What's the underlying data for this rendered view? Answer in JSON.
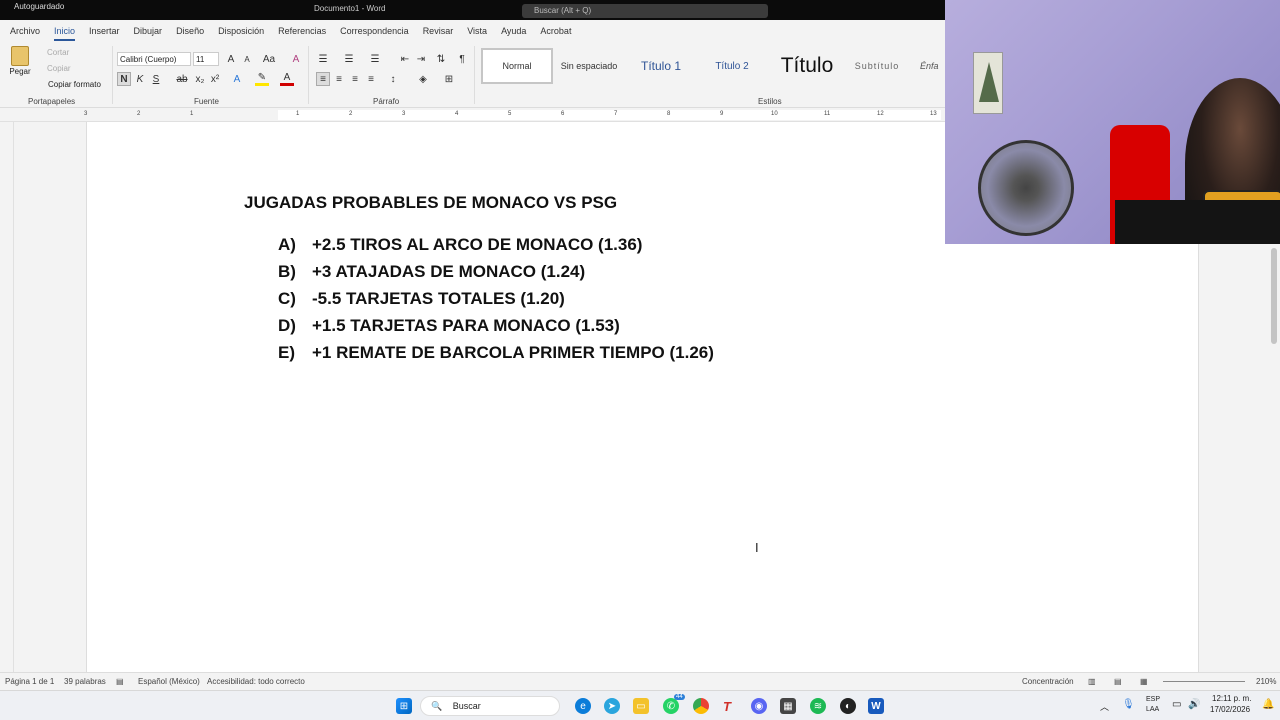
{
  "window": {
    "autosave": "Autoguardado",
    "doc_title": "Documento1 - Word",
    "search_placeholder": "Buscar (Alt + Q)"
  },
  "menu": {
    "tabs": [
      "Archivo",
      "Inicio",
      "Insertar",
      "Dibujar",
      "Diseño",
      "Disposición",
      "Referencias",
      "Correspondencia",
      "Revisar",
      "Vista",
      "Ayuda",
      "Acrobat"
    ],
    "active": "Inicio"
  },
  "ribbon": {
    "clipboard": {
      "paste": "Pegar",
      "cut": "Cortar",
      "copy": "Copiar",
      "format_painter": "Copiar formato",
      "label": "Portapapeles"
    },
    "font": {
      "name": "Calibri (Cuerpo)",
      "size": "11",
      "label": "Fuente",
      "bold": "N",
      "italic": "K",
      "underline": "S"
    },
    "paragraph": {
      "label": "Párrafo"
    },
    "styles": {
      "label": "Estilos",
      "items": [
        "Normal",
        "Sin espaciado",
        "Título 1",
        "Título 2",
        "Título",
        "Subtítulo",
        "Énfa"
      ]
    }
  },
  "ruler": {
    "numbers": [
      "3",
      "2",
      "1",
      "1",
      "2",
      "3",
      "4",
      "5",
      "6",
      "7",
      "8",
      "9",
      "10",
      "11",
      "12",
      "13"
    ]
  },
  "document": {
    "title": "JUGADAS PROBABLES DE MONACO VS PSG",
    "items": [
      {
        "letter": "A)",
        "text": "+2.5 TIROS AL ARCO DE MONACO (1.36)"
      },
      {
        "letter": "B)",
        "text": "+3 ATAJADAS DE MONACO (1.24)"
      },
      {
        "letter": "C)",
        "text": "-5.5 TARJETAS TOTALES (1.20)"
      },
      {
        "letter": "D)",
        "text": "+1.5 TARJETAS PARA MONACO (1.53)"
      },
      {
        "letter": "E)",
        "text": "+1 REMATE DE BARCOLA PRIMER TIEMPO (1.26)"
      }
    ]
  },
  "status": {
    "page": "Página 1 de 1",
    "words": "39 palabras",
    "language": "Español (México)",
    "accessibility": "Accesibilidad: todo correcto",
    "focus": "Concentración",
    "zoom": "210%"
  },
  "taskbar": {
    "search": "Buscar",
    "lang1": "ESP",
    "lang2": "LAA",
    "time": "12:11 p. m.",
    "date": "17/02/2026",
    "whatsapp_badge": "44"
  }
}
